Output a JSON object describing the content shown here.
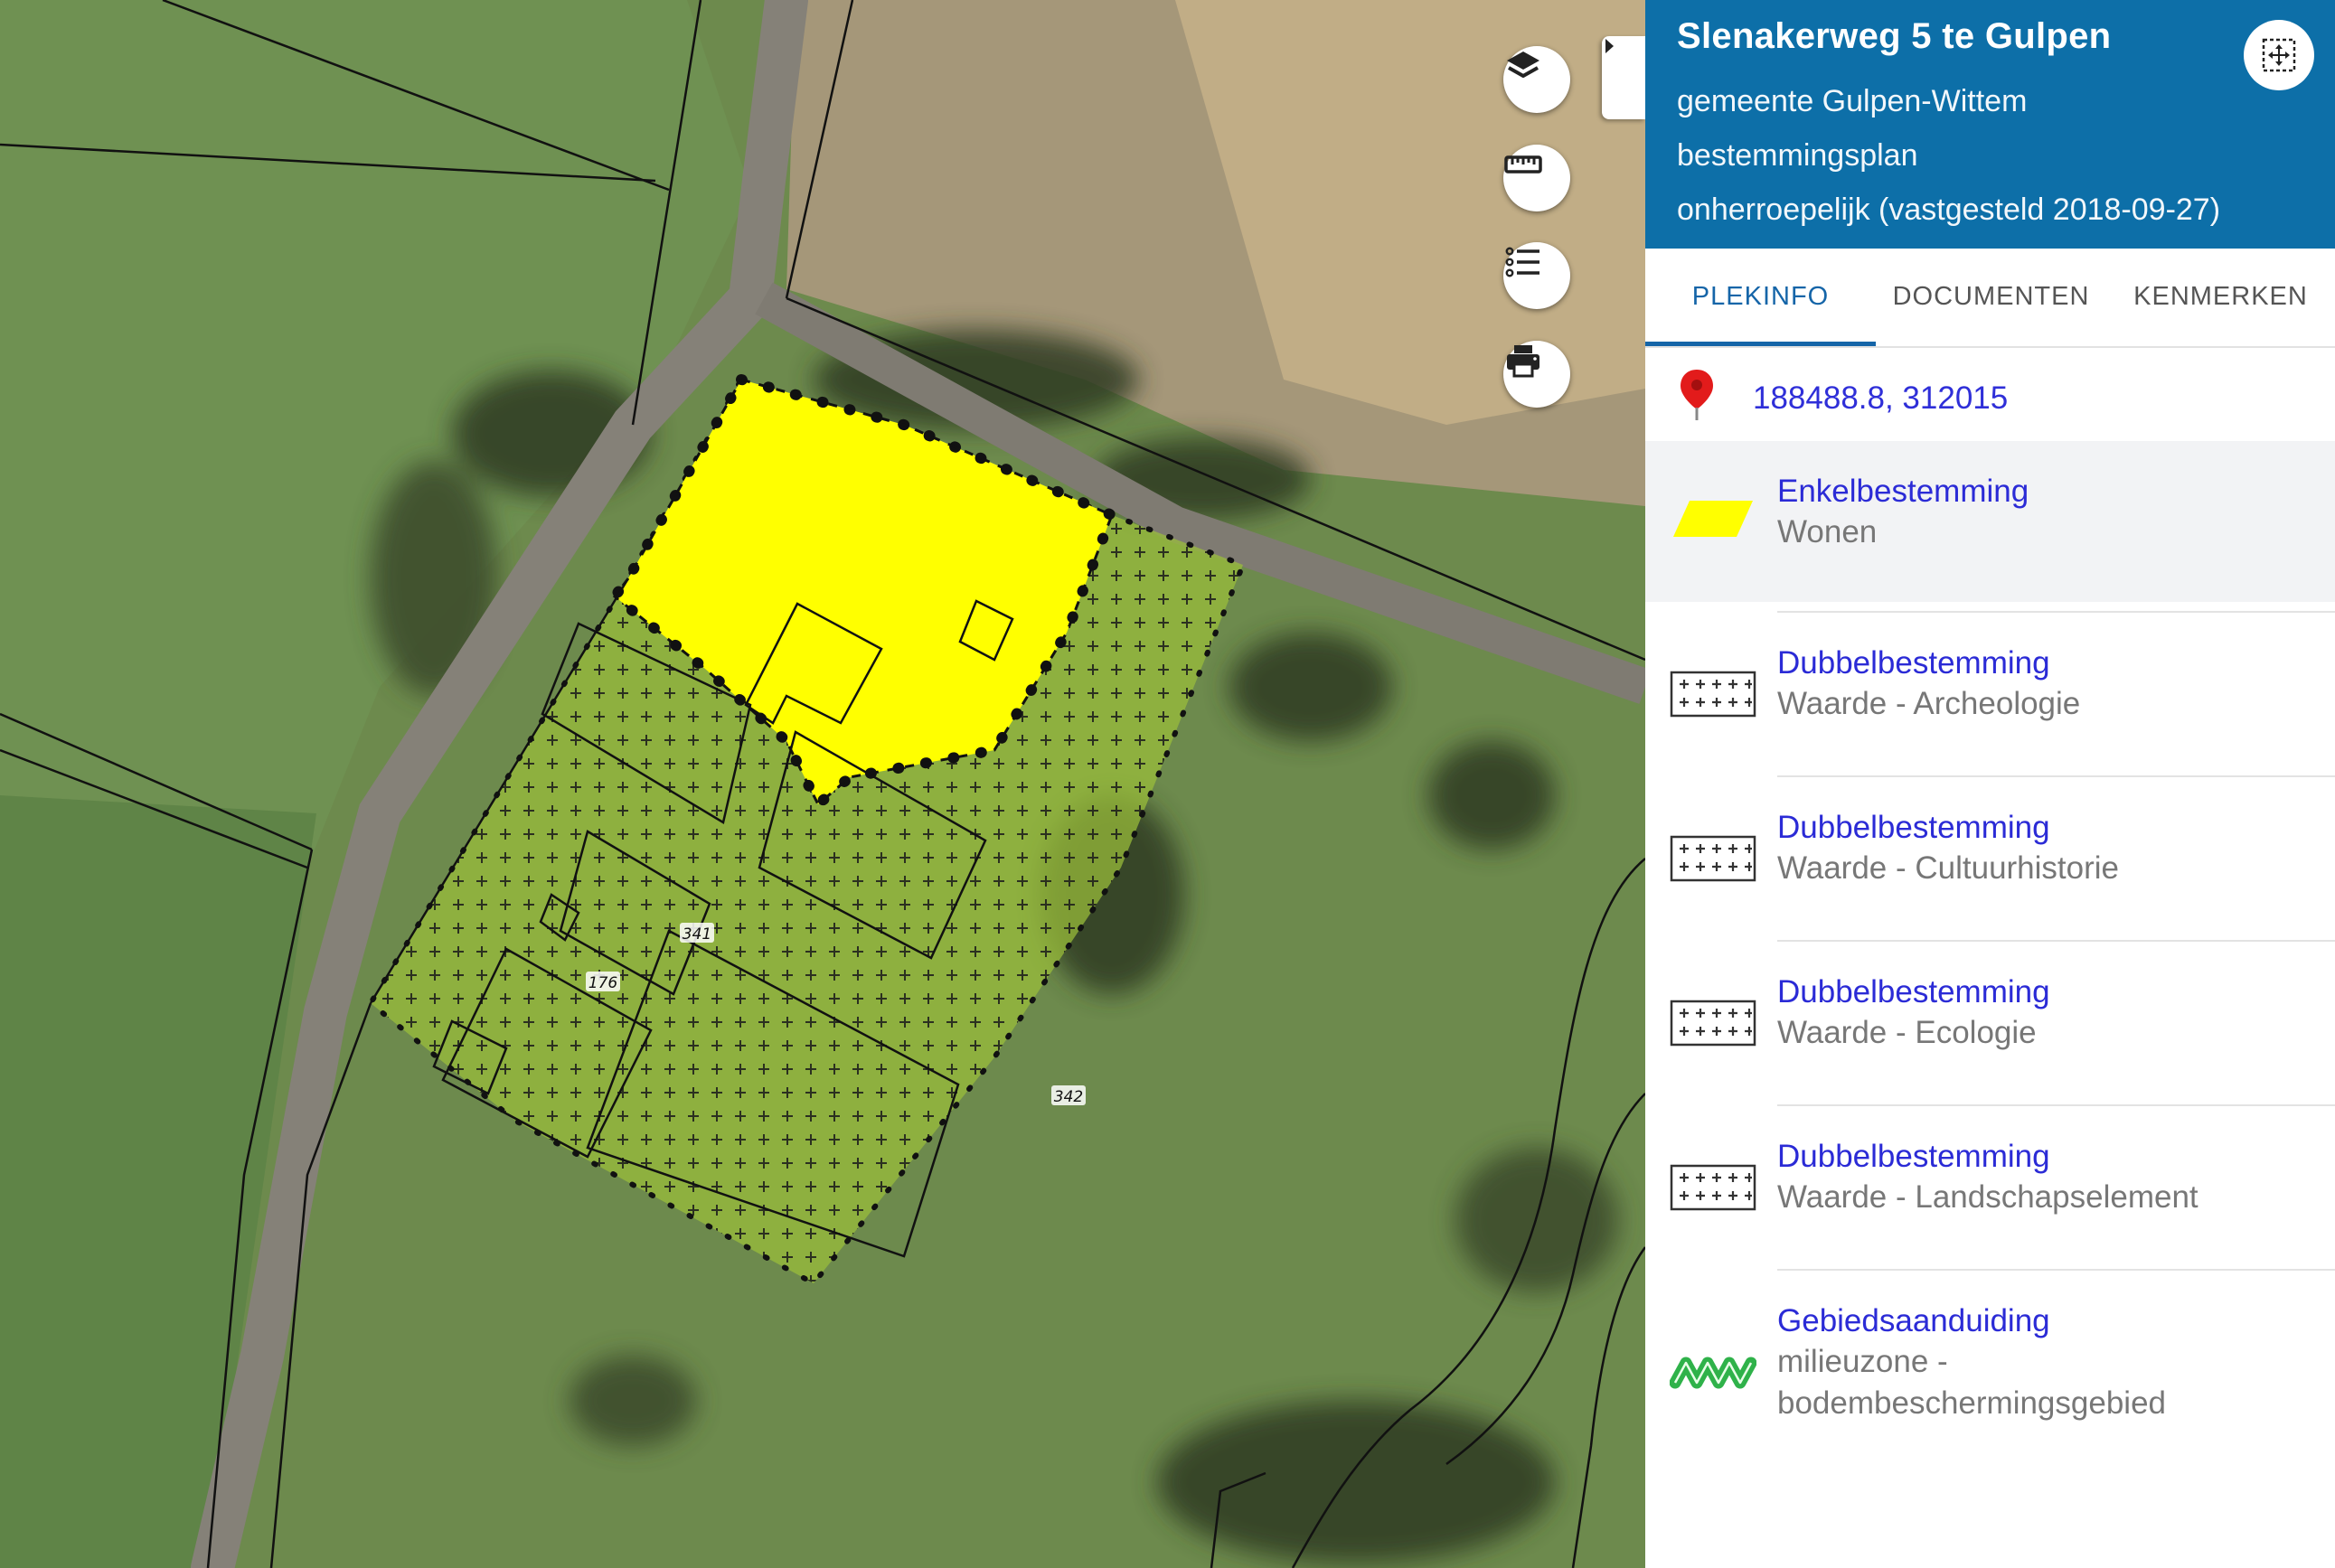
{
  "map": {
    "parcel_numbers": [
      "341",
      "176",
      "342"
    ],
    "controls": {
      "layers_icon": "layers-icon",
      "measure_icon": "ruler-icon",
      "legend_icon": "list-icon",
      "print_icon": "printer-icon"
    }
  },
  "panel": {
    "title": "Slenakerweg 5 te Gulpen",
    "municipality": "gemeente Gulpen-Wittem",
    "plan_type": "bestemmingsplan",
    "status": "onherroepelijk (vastgesteld 2018-09-27)",
    "tabs": [
      {
        "label": "PLEKINFO",
        "active": true
      },
      {
        "label": "DOCUMENTEN",
        "active": false
      },
      {
        "label": "KENMERKEN",
        "active": false
      }
    ],
    "coordinates": "188488.8, 312015",
    "entries": [
      {
        "title": "Enkelbestemming",
        "subtitle": "Wonen",
        "icon": "yellow-parallelogram-icon",
        "selected": true
      },
      {
        "title": "Dubbelbestemming",
        "subtitle": "Waarde - Archeologie",
        "icon": "cross-hatch-icon"
      },
      {
        "title": "Dubbelbestemming",
        "subtitle": "Waarde - Cultuurhistorie",
        "icon": "cross-hatch-icon"
      },
      {
        "title": "Dubbelbestemming",
        "subtitle": "Waarde - Ecologie",
        "icon": "cross-hatch-icon"
      },
      {
        "title": "Dubbelbestemming",
        "subtitle": "Waarde - Landschapselement",
        "icon": "cross-hatch-icon"
      },
      {
        "title": "Gebiedsaanduiding",
        "subtitle_line1": "milieuzone -",
        "subtitle_line2": "bodembeschermingsgebied",
        "icon": "green-zigzag-icon"
      }
    ]
  },
  "colors": {
    "header_blue": "#0d6fa8",
    "link_blue": "#2b2bd6",
    "wonen_yellow": "#ffff00",
    "dubbel_green": "#9bbf3a",
    "zone_green": "#2fb24a"
  }
}
